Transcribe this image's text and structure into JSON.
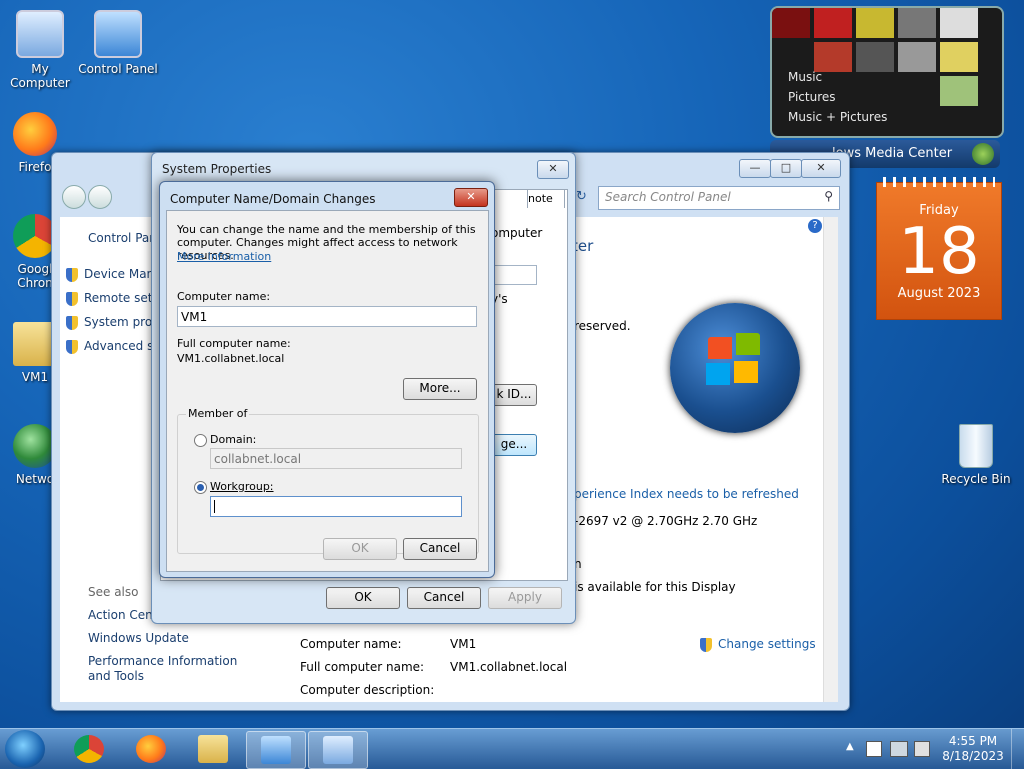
{
  "desktop": {
    "icons": [
      {
        "label": "My Computer"
      },
      {
        "label": "Control Panel"
      },
      {
        "label": "Firefo"
      },
      {
        "label": "Googl Chron"
      },
      {
        "label": "VM1"
      },
      {
        "label": "Netwo"
      },
      {
        "label": "Recycle Bin"
      }
    ]
  },
  "media_gadget": {
    "items": [
      "Music",
      "Pictures",
      "Music + Pictures"
    ],
    "bar_label": "lows Media Center"
  },
  "calendar_gadget": {
    "weekday": "Friday",
    "day": "18",
    "month_year": "August 2023"
  },
  "control_panel": {
    "search_placeholder": "Search Control Panel",
    "sidebar_title": "Control Pan",
    "tasks": [
      "Device Man",
      "Remote sett",
      "System prot",
      "Advanced sy"
    ],
    "see_also_title": "See also",
    "see_also": [
      "Action Cent",
      "Windows Update",
      "Performance Information and Tools"
    ],
    "main_title_fragment": "ter",
    "copyright_fragment": "reserved.",
    "wei_link": "perience Index needs to be refreshed",
    "processor_fragment": "-2697 v2 @ 2.70GHz   2.70 GHz",
    "pen_fragment": "n",
    "pen_touch_fragment": "is available for this Display",
    "computer_name_label": "Computer name:",
    "computer_name_value": "VM1",
    "full_name_label": "Full computer name:",
    "full_name_value": "VM1.collabnet.local",
    "description_label": "Computer description:",
    "change_settings": "Change settings"
  },
  "system_properties": {
    "title": "System Properties",
    "tab_fragment": "note",
    "desc_fragment": "omputer",
    "desc_fragment2": "y's",
    "network_id_fragment": "k ID...",
    "change_fragment": "ge...",
    "ok": "OK",
    "cancel": "Cancel",
    "apply": "Apply"
  },
  "dialog": {
    "title": "Computer Name/Domain Changes",
    "intro": "You can change the name and the membership of this computer. Changes might affect access to network resources.",
    "more_info": "More information",
    "computer_name_label": "Computer name:",
    "computer_name_value": "VM1",
    "full_name_label": "Full computer name:",
    "full_name_value": "VM1.collabnet.local",
    "more_button": "More...",
    "member_of": "Member of",
    "domain_label": "Domain:",
    "domain_value": "collabnet.local",
    "workgroup_label": "Workgroup:",
    "workgroup_value": "",
    "ok": "OK",
    "cancel": "Cancel"
  },
  "taskbar": {
    "time": "4:55 PM",
    "date": "8/18/2023"
  }
}
